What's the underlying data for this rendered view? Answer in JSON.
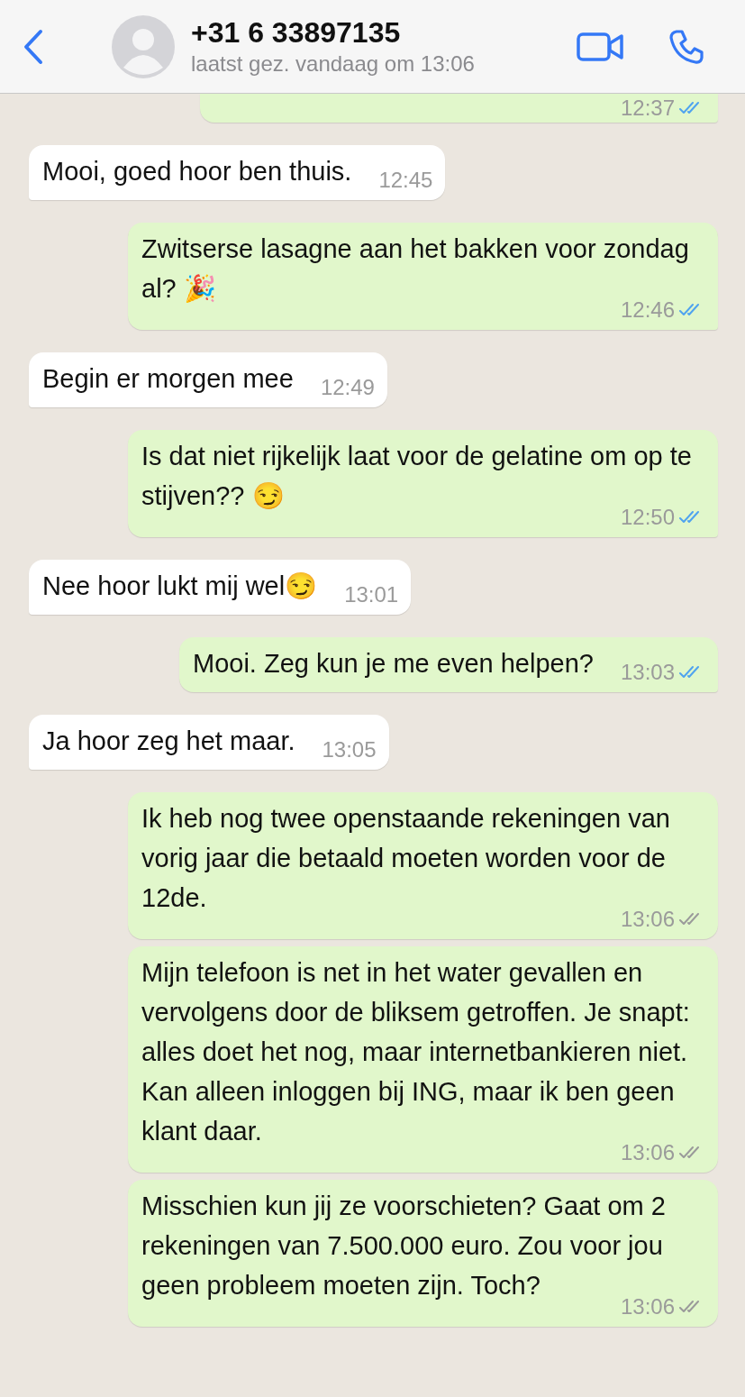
{
  "header": {
    "contact": "+31 6 33897135",
    "last_seen": "laatst gez. vandaag om 13:06"
  },
  "messages": [
    {
      "outgoing": true,
      "partial": true,
      "time": "12:37",
      "read": true,
      "tail": true
    },
    {
      "outgoing": false,
      "text": "Mooi, goed hoor ben thuis.",
      "time": "12:45",
      "tail": true
    },
    {
      "outgoing": true,
      "text": "Zwitserse lasagne aan het bakken voor zondag al? 🎉",
      "time": "12:46",
      "read": true,
      "tail": true
    },
    {
      "outgoing": false,
      "text": "Begin er morgen mee",
      "time": "12:49",
      "tail": true
    },
    {
      "outgoing": true,
      "text": "Is dat niet rijkelijk laat voor de gelatine om op te stijven?? 😏",
      "time": "12:50",
      "read": true,
      "tail": true
    },
    {
      "outgoing": false,
      "text": "Nee hoor lukt mij wel😏",
      "time": "13:01",
      "tail": true
    },
    {
      "outgoing": true,
      "text": "Mooi. Zeg kun je me even helpen?",
      "time": "13:03",
      "read": true,
      "tail": true
    },
    {
      "outgoing": false,
      "text": "Ja hoor zeg het maar.",
      "time": "13:05",
      "tail": true
    },
    {
      "outgoing": true,
      "text": "Ik heb nog twee openstaande rekeningen van vorig jaar die betaald moeten worden voor de 12de.",
      "time": "13:06",
      "read": false,
      "tail": false
    },
    {
      "outgoing": true,
      "text": "Mijn telefoon is net in het water gevallen en vervolgens door de bliksem getroffen. Je snapt: alles doet het nog, maar internetbankieren niet. Kan alleen inloggen bij ING, maar ik ben geen klant daar.",
      "time": "13:06",
      "read": false,
      "tail": false
    },
    {
      "outgoing": true,
      "text": "Misschien kun jij ze voorschieten? Gaat om 2 rekeningen van 7.500.000 euro. Zou voor jou geen probleem moeten zijn. Toch?",
      "time": "13:06",
      "read": false,
      "tail": false
    }
  ]
}
